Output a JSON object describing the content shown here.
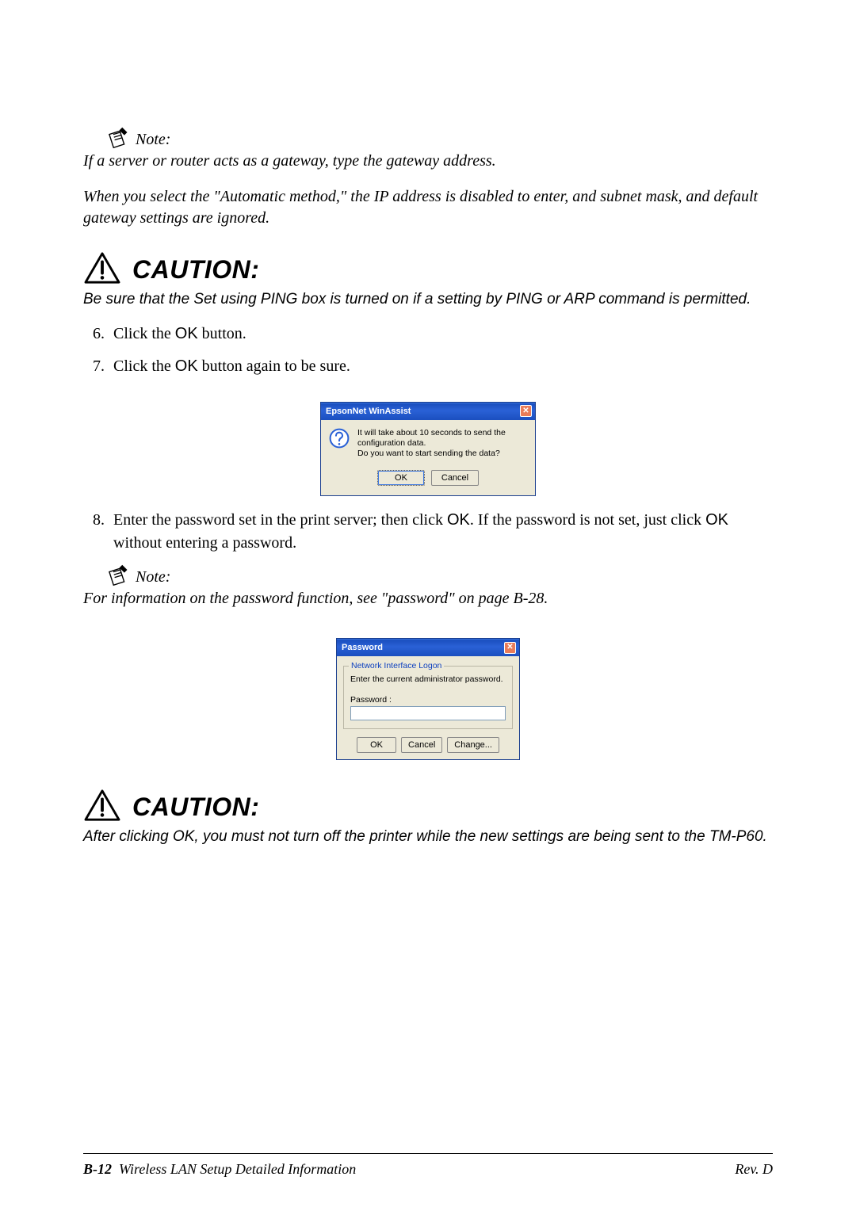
{
  "note1": {
    "label": "Note:",
    "line1": "If a server or router acts as a gateway, type the gateway address.",
    "line2": "When you select the \"Automatic method,\" the IP address is disabled to enter, and subnet mask, and default gateway settings are ignored."
  },
  "caution1": {
    "label": "CAUTION:",
    "body": "Be sure that the Set using PING box is turned on if a setting by PING or ARP command is permitted."
  },
  "steps": {
    "s6_a": "Click the ",
    "s6_ok": "OK",
    "s6_b": " button.",
    "s7_a": "Click the ",
    "s7_ok": "OK",
    "s7_b": " button again to be sure.",
    "s8_a": "Enter the password set in the print server; then click ",
    "s8_ok1": "OK",
    "s8_b": ". If the password is not set, just click ",
    "s8_ok2": "OK",
    "s8_c": " without entering a password."
  },
  "dialog1": {
    "title": "EpsonNet WinAssist",
    "msg1": "It will take about 10 seconds to send the configuration data.",
    "msg2": "Do you want to start sending the data?",
    "ok": "OK",
    "cancel": "Cancel"
  },
  "note2": {
    "label": "Note:",
    "body": "For information on the password function, see \"password\" on page B-28."
  },
  "dialog2": {
    "title": "Password",
    "legend": "Network Interface Logon",
    "prompt": "Enter the current administrator password.",
    "pwd_label": "Password :",
    "pwd_value": "",
    "ok": "OK",
    "cancel": "Cancel",
    "change": "Change..."
  },
  "caution2": {
    "label": "CAUTION:",
    "body": "After clicking OK, you must not turn off the printer while the new settings are being sent to the TM-P60."
  },
  "footer": {
    "page_num": "B-12",
    "title": "Wireless LAN Setup Detailed Information",
    "rev": "Rev. D"
  }
}
